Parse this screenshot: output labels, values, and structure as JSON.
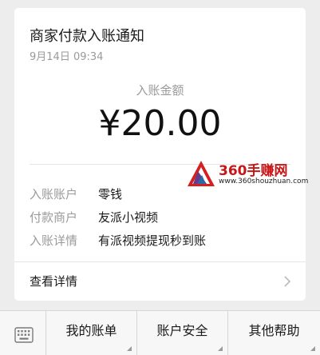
{
  "card": {
    "title": "商家付款入账通知",
    "time": "9月14日  09:34",
    "amount_label": "入账金额",
    "amount": "¥20.00",
    "details": [
      {
        "label": "入账账户",
        "value": "零钱"
      },
      {
        "label": "付款商户",
        "value": "友派小视频"
      },
      {
        "label": "入账详情",
        "value": "有派视频提现秒到账"
      }
    ],
    "view_details": "查看详情"
  },
  "watermark": {
    "text": "360手赚网",
    "url": "www.360shouzhuan.com"
  },
  "menu": {
    "items": [
      "我的账单",
      "账户安全",
      "其他帮助"
    ]
  }
}
